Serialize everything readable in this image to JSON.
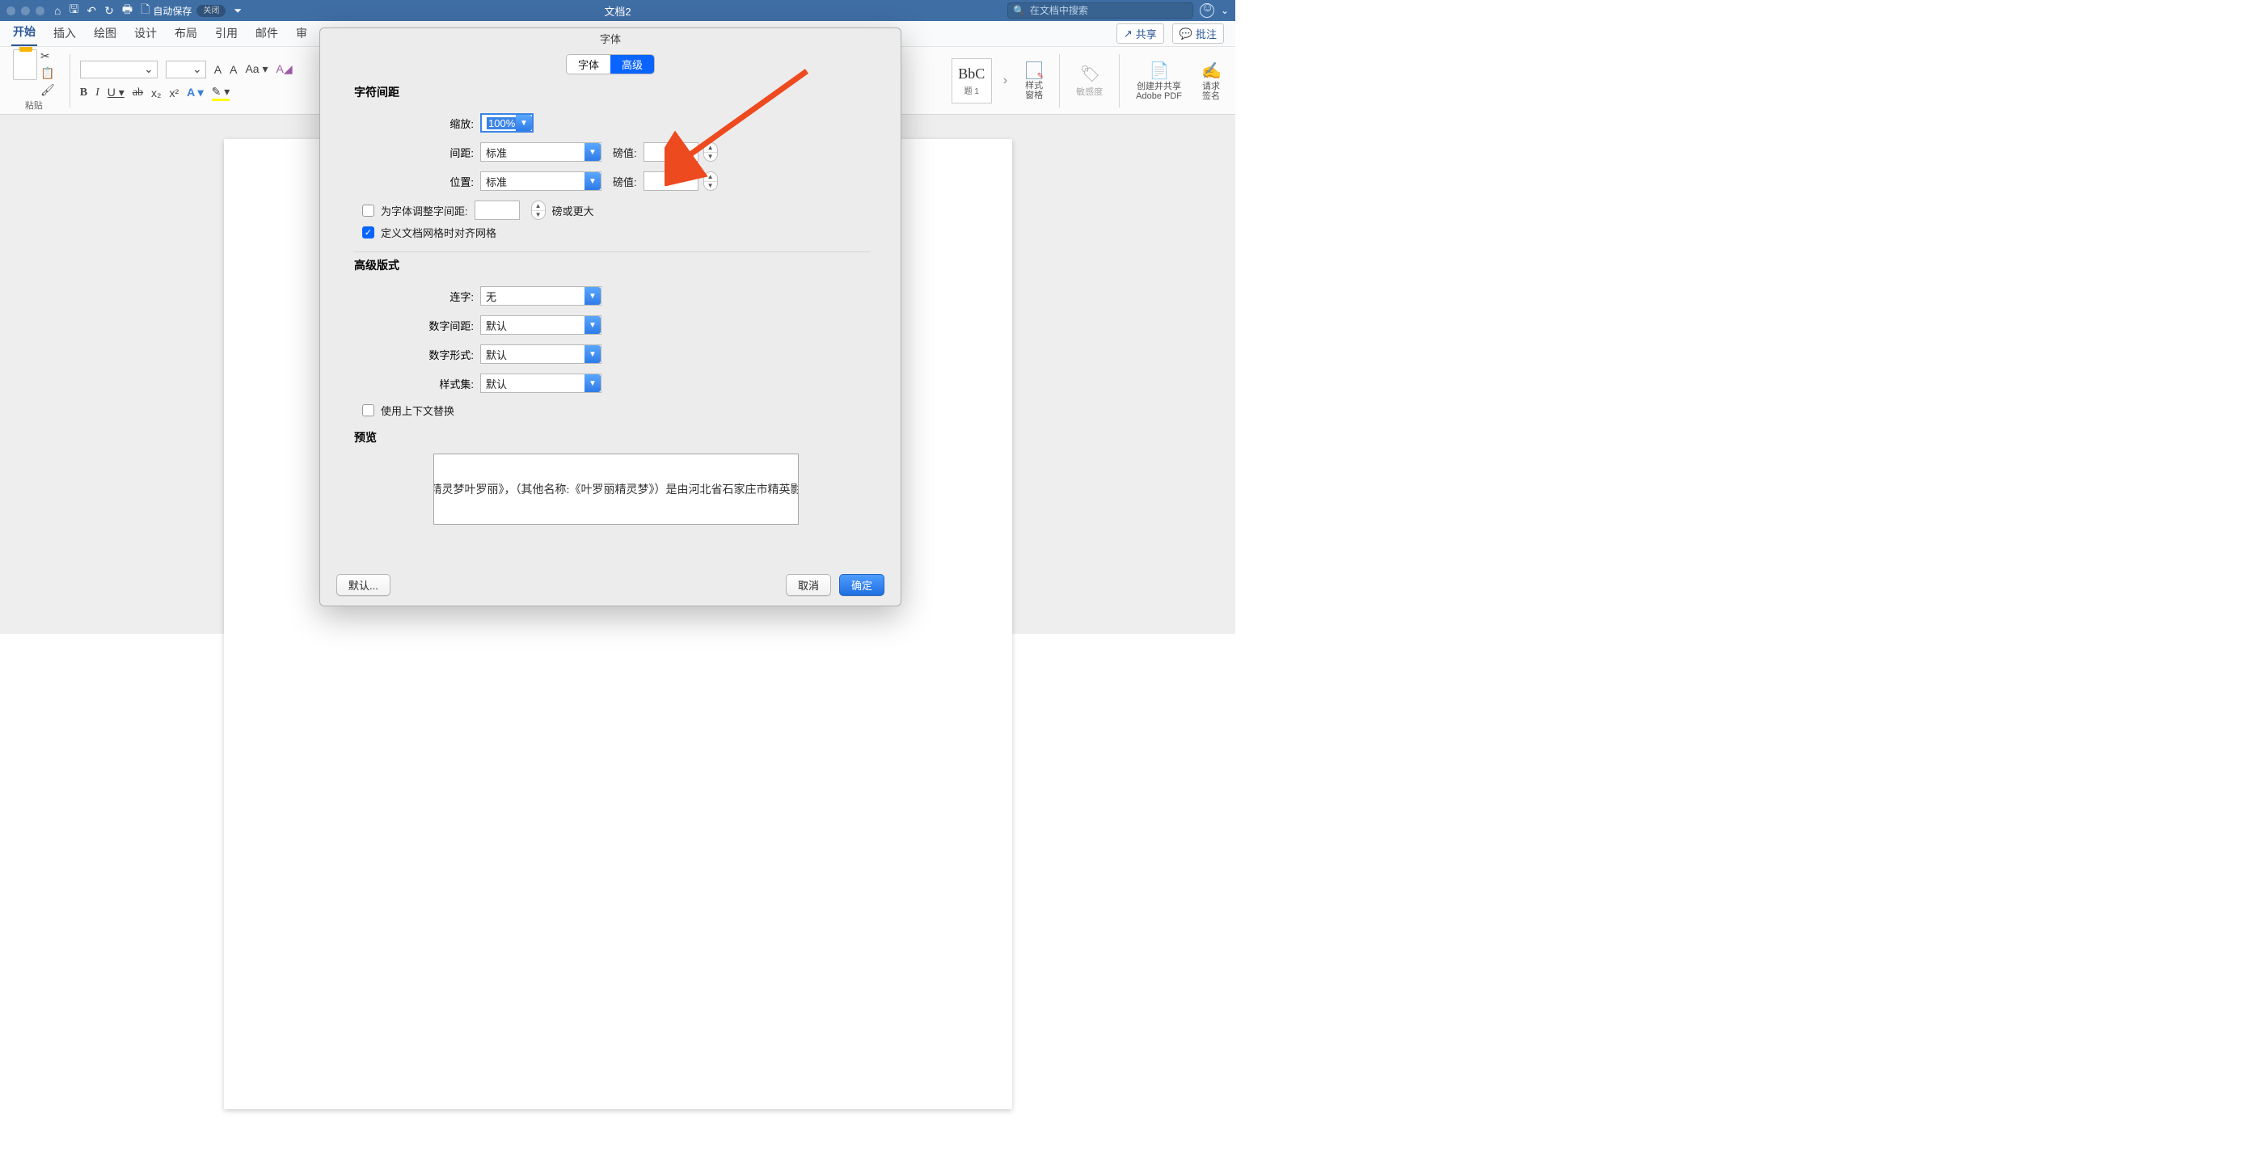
{
  "titlebar": {
    "doc_title": "文档2",
    "autosave_label": "自动保存",
    "autosave_state": "关闭",
    "search_placeholder": "在文档中搜索"
  },
  "ribbon_tabs": {
    "items": [
      "开始",
      "插入",
      "绘图",
      "设计",
      "布局",
      "引用",
      "邮件",
      "审"
    ],
    "active_index": 0,
    "share": "共享",
    "comments": "批注"
  },
  "ribbon": {
    "paste": "粘贴",
    "style_thumb_top": "BbC",
    "style_thumb_bottom": "题 1",
    "style_pane1": "样式",
    "style_pane2": "窗格",
    "sensitivity": "敏感度",
    "create_pdf1": "创建并共享",
    "create_pdf2": "Adobe PDF",
    "sign1": "请求",
    "sign2": "签名"
  },
  "dialog": {
    "title": "字体",
    "tabs": {
      "font": "字体",
      "advanced": "高级"
    },
    "section_spacing": "字符间距",
    "scale_label": "缩放:",
    "scale_value": "100%",
    "spacing_label": "间距:",
    "spacing_value": "标准",
    "point_label": "磅值:",
    "position_label": "位置:",
    "position_value": "标准",
    "kerning_label": "为字体调整字间距:",
    "kerning_suffix": "磅或更大",
    "grid_align": "定义文档网格时对齐网格",
    "section_opentype": "高级版式",
    "ligatures_label": "连字:",
    "ligatures_value": "无",
    "numspacing_label": "数字间距:",
    "numspacing_value": "默认",
    "numform_label": "数字形式:",
    "numform_value": "默认",
    "styleset_label": "样式集:",
    "styleset_value": "默认",
    "contextual": "使用上下文替换",
    "preview_label": "预览",
    "preview_text": "《精灵梦叶罗丽》，（其他名称:《叶罗丽精灵梦》）是由河北省石家庄市精英影视",
    "btn_default": "默认...",
    "btn_cancel": "取消",
    "btn_ok": "确定"
  }
}
